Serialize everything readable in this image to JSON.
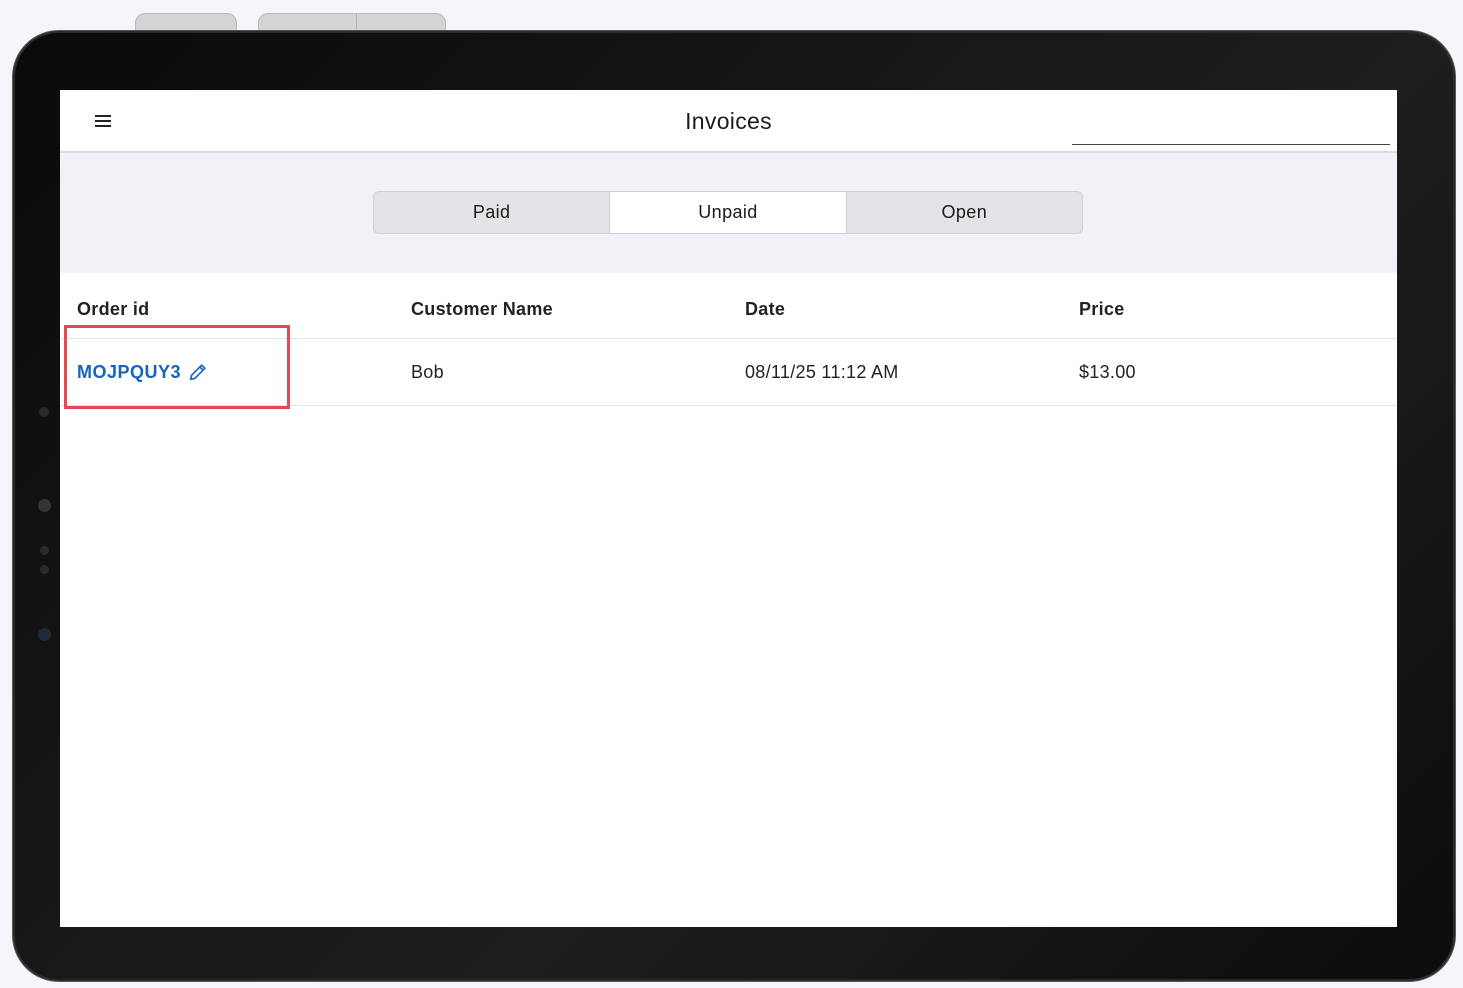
{
  "app": {
    "title": "Invoices",
    "search": {
      "value": "",
      "placeholder": ""
    }
  },
  "filter_tabs": [
    {
      "label": "Paid",
      "active": false
    },
    {
      "label": "Unpaid",
      "active": true
    },
    {
      "label": "Open",
      "active": false
    }
  ],
  "table": {
    "columns": [
      "Order id",
      "Customer Name",
      "Date",
      "Price"
    ],
    "rows": [
      {
        "order_id": "MOJPQUY3",
        "customer": "Bob",
        "date": "08/11/25 11:12 AM",
        "price": "$13.00"
      }
    ]
  },
  "icons": {
    "menu": "hamburger-menu-icon",
    "edit": "pencil-edit-icon"
  },
  "colors": {
    "link": "#1565c0",
    "highlight": "#e5484d",
    "filter_bg": "#f1f2f5"
  }
}
